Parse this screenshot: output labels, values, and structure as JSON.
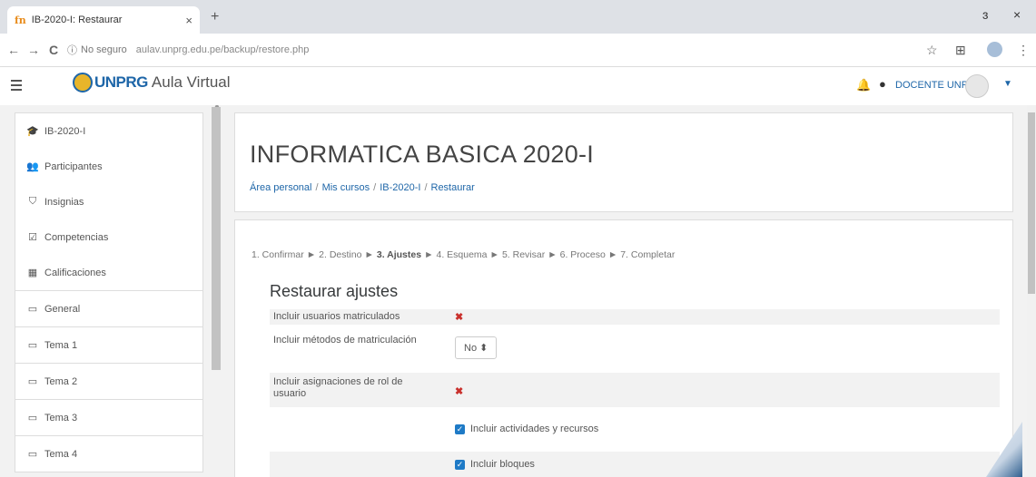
{
  "browser": {
    "tab": {
      "favicon": "fn",
      "title": "IB-2020-I: Restaurar",
      "close": "×"
    },
    "new_tab": "+",
    "window_controls": {
      "minimize": "ɜ",
      "close": "×"
    },
    "nav": {
      "back": "←",
      "forward": "→",
      "reload": "C"
    },
    "address": {
      "security_icon": "ⓘ",
      "security_label": "No seguro",
      "url": "aulav.unprg.edu.pe/backup/restore.php"
    },
    "right_icons": {
      "star": "☆",
      "extensions": "⊞",
      "menu": "⋮"
    }
  },
  "navbar": {
    "menu_icon": "hamburger-icon",
    "logo_text": "UNPRG",
    "site_name": "Aula Virtual",
    "user_name": "DOCENTE UNPRG",
    "bell": "🔔",
    "chat": "●",
    "caret": "▼"
  },
  "drawer": {
    "items": [
      {
        "icon": "🎓",
        "label": "IB-2020-I"
      },
      {
        "icon": "👥",
        "label": "Participantes"
      },
      {
        "icon": "⛉",
        "label": "Insignias"
      },
      {
        "icon": "☑",
        "label": "Competencias"
      },
      {
        "icon": "▦",
        "label": "Calificaciones"
      },
      {
        "icon": "▭",
        "label": "General"
      },
      {
        "icon": "▭",
        "label": "Tema 1"
      },
      {
        "icon": "▭",
        "label": "Tema 2"
      },
      {
        "icon": "▭",
        "label": "Tema 3"
      },
      {
        "icon": "▭",
        "label": "Tema 4"
      }
    ]
  },
  "header": {
    "course_title": "INFORMATICA BASICA 2020-I",
    "breadcrumb": [
      "Área personal",
      "Mis cursos",
      "IB-2020-I",
      "Restaurar"
    ],
    "breadcrumb_sep": "/"
  },
  "steps": {
    "items": [
      "1. Confirmar",
      "2. Destino",
      "3. Ajustes",
      "4. Esquema",
      "5. Revisar",
      "6. Proceso",
      "7. Completar"
    ],
    "current_index": 2,
    "arrow": "►"
  },
  "settings": {
    "title": "Restaurar ajustes",
    "rows": [
      {
        "label": "Incluir usuarios matriculados",
        "value": "✖"
      },
      {
        "label": "Incluir métodos de matriculación",
        "select": "No ⬍"
      },
      {
        "label": "Incluir asignaciones de rol de usuario",
        "value": "✖"
      },
      {
        "label": "",
        "checkbox": "Incluir actividades y recursos",
        "checked": true
      },
      {
        "label": "",
        "checkbox": "Incluir bloques",
        "checked": true
      }
    ],
    "check_glyph": "✓"
  }
}
